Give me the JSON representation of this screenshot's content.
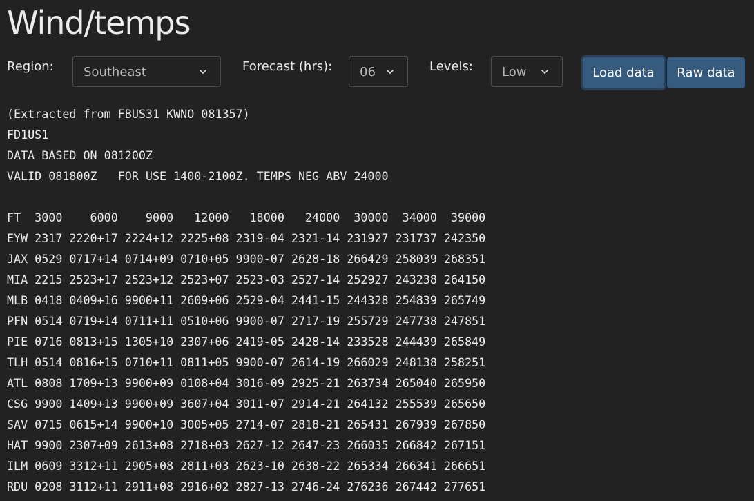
{
  "title": "Wind/temps",
  "controls": {
    "region": {
      "label": "Region:",
      "value": "Southeast"
    },
    "forecast": {
      "label": "Forecast (hrs):",
      "value": "06"
    },
    "levels": {
      "label": "Levels:",
      "value": "Low"
    },
    "load_button": "Load data",
    "raw_button": "Raw data"
  },
  "report": {
    "lines": [
      "(Extracted from FBUS31 KWNO 081357)",
      "FD1US1",
      "DATA BASED ON 081200Z",
      "VALID 081800Z   FOR USE 1400-2100Z. TEMPS NEG ABV 24000",
      "",
      "FT  3000    6000    9000   12000   18000   24000  30000  34000  39000",
      "EYW 2317 2220+17 2224+12 2225+08 2319-04 2321-14 231927 231737 242350",
      "JAX 0529 0717+14 0714+09 0710+05 9900-07 2628-18 266429 258039 268351",
      "MIA 2215 2523+17 2523+12 2523+07 2523-03 2527-14 252927 243238 264150",
      "MLB 0418 0409+16 9900+11 2609+06 2529-04 2441-15 244328 254839 265749",
      "PFN 0514 0719+14 0711+11 0510+06 9900-07 2717-19 255729 247738 247851",
      "PIE 0716 0813+15 1305+10 2307+06 2419-05 2428-14 233528 244439 265849",
      "TLH 0514 0816+15 0710+11 0811+05 9900-07 2614-19 266029 248138 258251",
      "ATL 0808 1709+13 9900+09 0108+04 3016-09 2925-21 263734 265040 265950",
      "CSG 9900 1409+13 9900+09 3607+04 3011-07 2914-21 264132 255539 265650",
      "SAV 0715 0615+14 9900+10 3005+05 2714-07 2818-21 265431 267939 267850",
      "HAT 9900 2307+09 2613+08 2718+03 2627-12 2647-23 266035 266842 267151",
      "ILM 0609 3312+11 2905+08 2811+03 2623-10 2638-22 265334 266341 266651",
      "RDU 0208 3112+11 2911+08 2916+02 2827-13 2746-24 276236 267442 277651"
    ]
  }
}
